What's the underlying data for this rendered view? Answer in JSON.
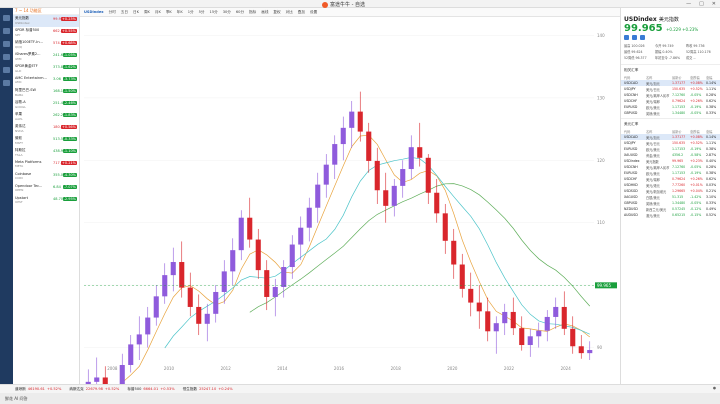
{
  "app": {
    "title": "富途牛牛 - 自选",
    "bottom_line": "鲜花 AI 问答"
  },
  "watchlist": {
    "tab": "7 ~ 14 功能区",
    "items": [
      {
        "name": "美元指数",
        "code": "USDindex",
        "price": "99.965",
        "change": "+0.23%",
        "dir": "up",
        "selected": true
      },
      {
        "name": "SPDR 标普500",
        "code": "SPY",
        "price": "662.34",
        "change": "+0.55%",
        "dir": "up",
        "selected": false
      },
      {
        "name": "纳指100ETF-In...",
        "code": "QQQ",
        "price": "574.22",
        "change": "+0.68%",
        "dir": "up",
        "selected": false
      },
      {
        "name": "iShares罗素2...",
        "code": "IWM",
        "price": "241.60",
        "change": "-1.05%",
        "dir": "dn",
        "selected": false
      },
      {
        "name": "SPDR黄金ETF",
        "code": "GLD",
        "price": "373.82",
        "change": "-1.62%",
        "dir": "dn",
        "selected": false
      },
      {
        "name": "AMC Entertainm...",
        "code": "AMC",
        "price": "3.06",
        "change": "-3.73%",
        "dir": "dn",
        "selected": false
      },
      {
        "name": "阿里巴巴-SW",
        "code": "BABA",
        "price": "168.10",
        "change": "-1.50%",
        "dir": "dn",
        "selected": false
      },
      {
        "name": "谷歌-A",
        "code": "GOOGL",
        "price": "251.46",
        "change": "-2.46%",
        "dir": "dn",
        "selected": false
      },
      {
        "name": "苹果",
        "code": "AAPL",
        "price": "262.24",
        "change": "-1.83%",
        "dir": "dn",
        "selected": false
      },
      {
        "name": "英伟达",
        "code": "NVDA",
        "price": "180.03",
        "change": "+0.56%",
        "dir": "up",
        "selected": false
      },
      {
        "name": "微软",
        "code": "MSFT",
        "price": "513.58",
        "change": "-0.33%",
        "dir": "dn",
        "selected": false
      },
      {
        "name": "特斯拉",
        "code": "TSLA",
        "price": "438.97",
        "change": "-1.10%",
        "dir": "dn",
        "selected": false
      },
      {
        "name": "Meta Platforms",
        "code": "META",
        "price": "717.55",
        "change": "+0.21%",
        "dir": "up",
        "selected": false
      },
      {
        "name": "Coinbase",
        "code": "COIN",
        "price": "355.08",
        "change": "-4.30%",
        "dir": "dn",
        "selected": false
      },
      {
        "name": "Opendoor Tec...",
        "code": "OPEN",
        "price": "6.84",
        "change": "-7.07%",
        "dir": "dn",
        "selected": false
      },
      {
        "name": "Upstart",
        "code": "UPST",
        "price": "48.70",
        "change": "-2.95%",
        "dir": "dn",
        "selected": false
      }
    ]
  },
  "toolbar": {
    "symbol": "USDindex",
    "items": [
      "分时",
      "五日",
      "日K",
      "周K",
      "月K",
      "季K",
      "年K",
      "1分",
      "5分",
      "15分",
      "30分",
      "60分",
      "指标",
      "画线",
      "复权",
      "对比",
      "叠加",
      "设置"
    ]
  },
  "panel": {
    "symbol": "USDindex",
    "name": "美元指数",
    "price": "99.965",
    "change": "+0.229 +0.23%",
    "stats": [
      "最高 100.026",
      "今开 99.749",
      "昨收 99.736",
      "最低 99.624",
      "振幅 0.40%",
      "52周高 110.176",
      "52周低 96.377",
      "年初至今 -7.86%",
      "成交 --"
    ],
    "table1_title": "相关汇率",
    "table2_title": "美元汇率",
    "table_headers": [
      "代码",
      "名称",
      "最新价",
      "涨跌幅",
      "涨幅"
    ],
    "table1": [
      {
        "code": "USDCAD",
        "name": "美元/加元",
        "price": "1.37177",
        "chg": "+0.08%",
        "pct": "0.14%",
        "selected": true
      },
      {
        "code": "USDJPY",
        "name": "美元/日元",
        "price": "150.635",
        "chg": "+0.52%",
        "pct": "1.11%",
        "selected": false
      },
      {
        "code": "USDCNH",
        "name": "美元/离岸人民币",
        "price": "7.12760",
        "chg": "-0.05%",
        "pct": "0.28%",
        "selected": false
      },
      {
        "code": "USDCHF",
        "name": "美元/瑞郎",
        "price": "0.79624",
        "chg": "+0.26%",
        "pct": "0.62%",
        "selected": false
      },
      {
        "code": "EURUSD",
        "name": "欧元/美元",
        "price": "1.17153",
        "chg": "-0.19%",
        "pct": "0.38%",
        "selected": false
      },
      {
        "code": "GBPUSD",
        "name": "英镑/美元",
        "price": "1.34480",
        "chg": "-0.05%",
        "pct": "0.33%",
        "selected": false
      }
    ],
    "table2": [
      {
        "code": "USDCAD",
        "name": "美元/加元",
        "price": "1.37177",
        "chg": "+0.08%",
        "pct": "0.14%",
        "selected": true
      },
      {
        "code": "USDJPY",
        "name": "美元/日元",
        "price": "150.635",
        "chg": "+0.52%",
        "pct": "1.11%",
        "selected": false
      },
      {
        "code": "EURUSD",
        "name": "欧元/美元",
        "price": "1.17153",
        "chg": "-0.19%",
        "pct": "0.38%",
        "selected": false
      },
      {
        "code": "XAUUSD",
        "name": "黄金/美元",
        "price": "4356.2",
        "chg": "-0.58%",
        "pct": "2.87%",
        "selected": false
      },
      {
        "code": "USDindex",
        "name": "美元指数",
        "price": "99.965",
        "chg": "+0.23%",
        "pct": "0.40%",
        "selected": false
      },
      {
        "code": "USDCNH",
        "name": "美元/离岸人民币",
        "price": "7.12760",
        "chg": "-0.05%",
        "pct": "0.28%",
        "selected": false
      },
      {
        "code": "EURUSD",
        "name": "欧元/美元",
        "price": "1.17153",
        "chg": "-0.19%",
        "pct": "0.38%",
        "selected": false
      },
      {
        "code": "USDCHF",
        "name": "美元/瑞郎",
        "price": "0.79624",
        "chg": "+0.26%",
        "pct": "0.62%",
        "selected": false
      },
      {
        "code": "USDHKD",
        "name": "美元/港元",
        "price": "7.77260",
        "chg": "+0.01%",
        "pct": "0.03%",
        "selected": false
      },
      {
        "code": "USDSGD",
        "name": "美元/新加坡元",
        "price": "1.29665",
        "chg": "+0.04%",
        "pct": "0.21%",
        "selected": false
      },
      {
        "code": "XAGUSD",
        "name": "白银/美元",
        "price": "51.315",
        "chg": "-1.42%",
        "pct": "3.10%",
        "selected": false
      },
      {
        "code": "GBPUSD",
        "name": "英镑/美元",
        "price": "1.34480",
        "chg": "-0.05%",
        "pct": "0.33%",
        "selected": false
      },
      {
        "code": "NZDUSD",
        "name": "新西兰元/美元",
        "price": "0.57245",
        "chg": "-0.12%",
        "pct": "0.49%",
        "selected": false
      },
      {
        "code": "AUDUSD",
        "name": "澳元/美元",
        "price": "0.65215",
        "chg": "-0.15%",
        "pct": "0.52%",
        "selected": false
      }
    ]
  },
  "indices": {
    "items": [
      {
        "name": "道琼斯",
        "value": "46190.61",
        "chg": "+0.52%",
        "dir": "up"
      },
      {
        "name": "纳斯达克",
        "value": "22679.98",
        "chg": "+0.52%",
        "dir": "up"
      },
      {
        "name": "标普500",
        "value": "6664.01",
        "chg": "+0.53%",
        "dir": "up"
      },
      {
        "name": "恒生指数",
        "value": "25247.10",
        "chg": "+0.24%",
        "dir": "up"
      }
    ]
  },
  "chart_data": {
    "type": "candlestick",
    "timeframe": "月K",
    "x_ticks": [
      "2008",
      "2010",
      "2012",
      "2014",
      "2016",
      "2018",
      "2020",
      "2022",
      "2024"
    ],
    "y_ticks": [
      90,
      100,
      110,
      120,
      130,
      140
    ],
    "ylim": [
      88,
      142
    ],
    "candles": [
      [
        80.6,
        86.5,
        78.5,
        84.5
      ],
      [
        84.5,
        88.4,
        83.0,
        85.2
      ],
      [
        85.2,
        87.0,
        80.0,
        81.5
      ],
      [
        81.5,
        84.0,
        79.0,
        83.6
      ],
      [
        83.6,
        89.0,
        82.0,
        87.2
      ],
      [
        87.2,
        92.0,
        86.0,
        90.5
      ],
      [
        90.5,
        95.0,
        88.0,
        92.1
      ],
      [
        92.1,
        96.5,
        90.0,
        94.8
      ],
      [
        94.8,
        100.0,
        93.5,
        98.2
      ],
      [
        98.2,
        103.5,
        97.0,
        101.6
      ],
      [
        101.6,
        106.0,
        99.0,
        103.7
      ],
      [
        103.7,
        107.0,
        98.0,
        99.6
      ],
      [
        99.6,
        102.0,
        95.0,
        96.5
      ],
      [
        96.5,
        98.5,
        92.0,
        93.8
      ],
      [
        93.8,
        97.0,
        91.0,
        95.4
      ],
      [
        95.4,
        100.0,
        94.0,
        98.9
      ],
      [
        98.9,
        104.0,
        97.0,
        102.2
      ],
      [
        102.2,
        107.5,
        100.0,
        105.6
      ],
      [
        105.6,
        112.0,
        104.0,
        110.8
      ],
      [
        110.8,
        114.0,
        106.0,
        107.3
      ],
      [
        107.3,
        109.0,
        101.0,
        102.4
      ],
      [
        102.4,
        104.0,
        96.0,
        98.1
      ],
      [
        98.1,
        101.0,
        95.0,
        99.7
      ],
      [
        99.7,
        104.0,
        98.0,
        102.9
      ],
      [
        102.9,
        108.0,
        101.0,
        106.5
      ],
      [
        106.5,
        111.0,
        104.0,
        109.2
      ],
      [
        109.2,
        114.0,
        107.0,
        112.4
      ],
      [
        112.4,
        118.0,
        110.0,
        116.1
      ],
      [
        116.1,
        121.0,
        114.0,
        119.3
      ],
      [
        119.3,
        124.0,
        117.0,
        122.6
      ],
      [
        122.6,
        127.0,
        120.0,
        125.2
      ],
      [
        125.2,
        129.5,
        122.0,
        127.8
      ],
      [
        127.8,
        131.0,
        123.0,
        124.6
      ],
      [
        124.6,
        126.0,
        118.0,
        119.9
      ],
      [
        119.9,
        122.0,
        113.0,
        115.2
      ],
      [
        115.2,
        118.0,
        110.0,
        112.7
      ],
      [
        112.7,
        117.0,
        111.0,
        115.9
      ],
      [
        115.9,
        120.0,
        114.0,
        118.6
      ],
      [
        118.6,
        124.0,
        117.0,
        122.1
      ],
      [
        122.1,
        126.0,
        119.0,
        120.4
      ],
      [
        120.4,
        121.0,
        113.0,
        114.8
      ],
      [
        114.8,
        117.0,
        110.0,
        111.5
      ],
      [
        111.5,
        113.0,
        105.0,
        107.1
      ],
      [
        107.1,
        109.0,
        101.0,
        103.3
      ],
      [
        103.3,
        105.0,
        98.0,
        99.4
      ],
      [
        99.4,
        102.0,
        95.0,
        97.2
      ],
      [
        97.2,
        100.0,
        93.0,
        95.8
      ],
      [
        95.8,
        98.0,
        91.0,
        92.6
      ],
      [
        92.6,
        95.0,
        89.0,
        93.9
      ],
      [
        93.9,
        97.0,
        92.0,
        95.7
      ],
      [
        95.7,
        98.0,
        92.0,
        93.1
      ],
      [
        93.1,
        95.0,
        89.5,
        90.4
      ],
      [
        90.4,
        93.0,
        88.5,
        91.8
      ],
      [
        91.8,
        94.0,
        90.0,
        92.7
      ],
      [
        92.7,
        96.0,
        91.0,
        94.9
      ],
      [
        94.9,
        98.0,
        93.0,
        96.5
      ],
      [
        96.5,
        99.0,
        92.0,
        93.0
      ],
      [
        93.0,
        95.0,
        89.0,
        90.2
      ],
      [
        90.2,
        92.0,
        88.2,
        89.1
      ],
      [
        89.1,
        91.0,
        88.0,
        89.6
      ]
    ],
    "ma_series": [
      {
        "name": "MA5",
        "color": "#e8a33d"
      },
      {
        "name": "MA10",
        "color": "#4cc4c9"
      },
      {
        "name": "MA20",
        "color": "#5fae5a"
      }
    ],
    "up_color": "#8f5bdc",
    "down_color": "#d9262c",
    "last_price": "99.965"
  }
}
